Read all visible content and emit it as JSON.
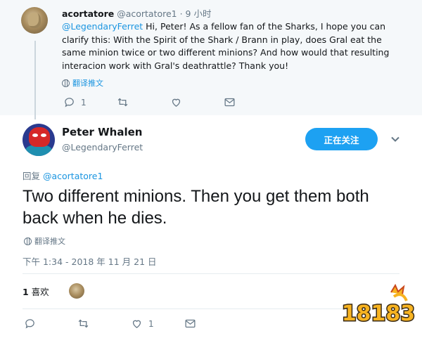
{
  "reply": {
    "display_name": "acortatore",
    "handle_time": "@acortatore1 · 9 小时",
    "mention": "@LegendaryFerret",
    "text": "  Hi, Peter! As a fellow fan of the Sharks, I hope you can clarify this: With the Spirit of the Shark / Brann in play, does Gral eat the same minion twice or two different minions? And how would that resulting interacion work with Gral's deathrattle? Thank you!",
    "translate": "翻译推文",
    "reply_count": "1"
  },
  "tweet": {
    "display_name": "Peter Whalen",
    "handle": "@LegendaryFerret",
    "follow_label": "正在关注",
    "replying_prefix": "回复 ",
    "replying_to": "@acortatore1",
    "text": "Two different minions. Then you get them both back when he dies.",
    "translate": "翻译推文",
    "timestamp": "下午 1:34 - 2018 年 11 月 21 日",
    "likes_count": "1",
    "likes_label": " 喜欢",
    "like_action_count": "1"
  },
  "watermark": {
    "text": "18183"
  },
  "colors": {
    "accent": "#1da1f2",
    "link": "#1b95e0",
    "muted": "#657786",
    "reply_bg": "#f5f8fa"
  },
  "icons": [
    "reply-icon",
    "retweet-icon",
    "like-icon",
    "dm-icon",
    "chevron-down-icon",
    "globe-icon"
  ]
}
